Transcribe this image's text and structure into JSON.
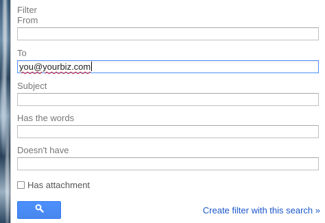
{
  "filter_panel": {
    "title": "Filter",
    "fields": [
      {
        "label": "From",
        "value": ""
      },
      {
        "label": "To",
        "value": "you@yourbiz.com"
      },
      {
        "label": "Subject",
        "value": ""
      },
      {
        "label": "Has the words",
        "value": ""
      },
      {
        "label": "Doesn't have",
        "value": ""
      }
    ],
    "has_attachment": {
      "label": "Has attachment",
      "checked": false
    },
    "search_button_icon": "magnifier-icon",
    "create_filter_link": "Create filter with this search »"
  },
  "colors": {
    "accent": "#4d90fe",
    "link": "#1a56c9",
    "label_text": "#777777"
  }
}
